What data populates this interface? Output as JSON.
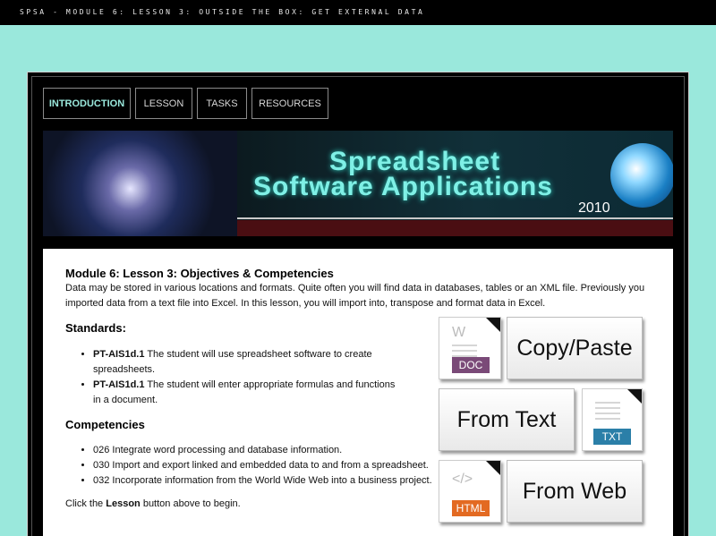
{
  "window": {
    "title": "SPSA - MODULE 6: LESSON 3: OUTSIDE THE BOX: GET EXTERNAL DATA"
  },
  "nav": {
    "tabs": [
      {
        "label": "INTRODUCTION",
        "active": true
      },
      {
        "label": "LESSON",
        "active": false
      },
      {
        "label": "TASKS",
        "active": false
      },
      {
        "label": "RESOURCES",
        "active": false
      }
    ]
  },
  "banner": {
    "line1": "Spreadsheet",
    "line2": "Software Applications",
    "year": "2010"
  },
  "content": {
    "heading": "Module 6: Lesson 3: Objectives & Competencies",
    "intro": "Data may be stored in various locations and formats. Quite often you will find data in databases, tables or an XML file. Previously you imported data from a text file into Excel. In this lesson, you will import into, transpose and format data in Excel.",
    "standards_title": "Standards:",
    "standards": [
      {
        "code": "PT-AIS1d.1",
        "text": " The student will use spreadsheet software to create spreadsheets."
      },
      {
        "code": "PT-AIS1d.1",
        "text": " The student will enter appropriate formulas and functions in a document."
      }
    ],
    "competencies_title": "Competencies",
    "competencies": [
      "026 Integrate word processing and database information.",
      "030 Import and export linked and embedded data to and from a spreadsheet.",
      "032 Incorporate information from the World Wide Web into a business project."
    ],
    "click_prefix": "Click the ",
    "click_bold": "Lesson",
    "click_suffix": " button above to begin."
  },
  "tiles": {
    "copy_paste": "Copy/Paste",
    "from_text": "From Text",
    "from_web": "From Web",
    "doc_label": "DOC",
    "txt_label": "TXT",
    "html_label": "HTML",
    "doc_glyph": "W",
    "html_glyph": "</>"
  },
  "colors": {
    "background": "#9ae8dc",
    "active_tab": "#9ae8dc",
    "doc_tag": "#7a4a78",
    "txt_tag": "#2b7fa8",
    "html_tag": "#e36a22"
  }
}
